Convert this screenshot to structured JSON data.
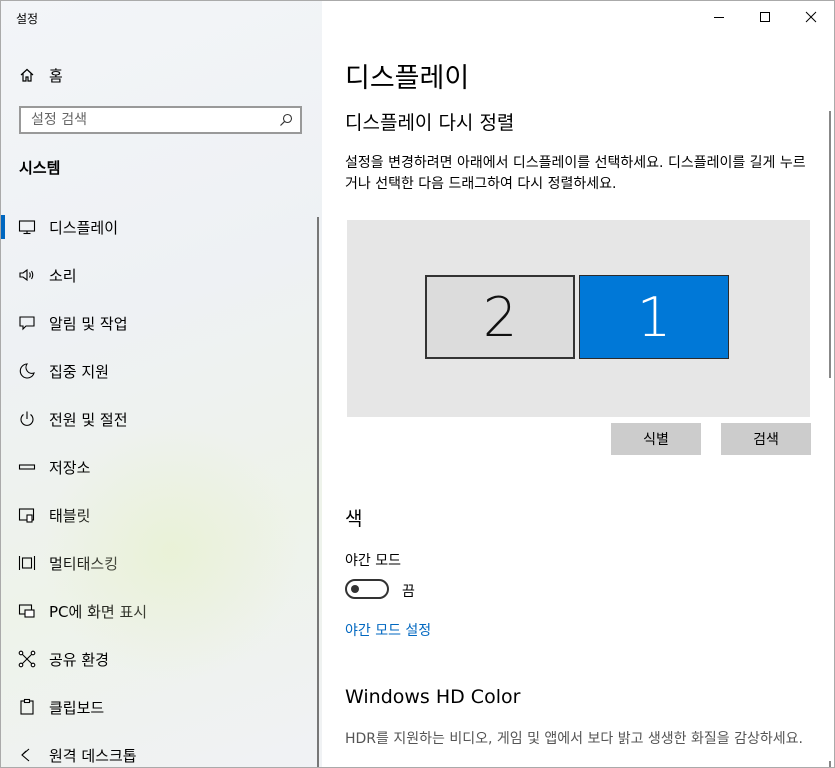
{
  "app": {
    "title": "설정"
  },
  "sidebar": {
    "home_label": "홈",
    "search_placeholder": "설정 검색",
    "section_title": "시스템",
    "items": [
      {
        "label": "디스플레이",
        "icon": "monitor-icon",
        "active": true
      },
      {
        "label": "소리",
        "icon": "speaker-icon"
      },
      {
        "label": "알림 및 작업",
        "icon": "notification-icon"
      },
      {
        "label": "집중 지원",
        "icon": "moon-icon"
      },
      {
        "label": "전원 및 절전",
        "icon": "power-icon"
      },
      {
        "label": "저장소",
        "icon": "storage-icon"
      },
      {
        "label": "태블릿",
        "icon": "tablet-icon"
      },
      {
        "label": "멀티태스킹",
        "icon": "multitasking-icon"
      },
      {
        "label": "PC에 화면 표시",
        "icon": "project-icon"
      },
      {
        "label": "공유 환경",
        "icon": "shared-experiences-icon"
      },
      {
        "label": "클립보드",
        "icon": "clipboard-icon"
      },
      {
        "label": "원격 데스크톱",
        "icon": "remote-desktop-icon"
      }
    ]
  },
  "main": {
    "title": "디스플레이",
    "arrange_title": "디스플레이 다시 정렬",
    "arrange_desc": "설정을 변경하려면 아래에서 디스플레이를 선택하세요. 디스플레이를 길게 누르거나 선택한 다음 드래그하여 다시 정렬하세요.",
    "monitors": [
      {
        "number": "2"
      },
      {
        "number": "1"
      }
    ],
    "identify_label": "식별",
    "detect_label": "검색",
    "color_title": "색",
    "night_light_label": "야간 모드",
    "night_light_state": "끔",
    "night_light_link": "야간 모드 설정",
    "hd_title": "Windows HD Color",
    "hd_desc": "HDR를 지원하는 비디오, 게임 및 앱에서 보다 밝고 생생한 화질을 감상하세요."
  },
  "colors": {
    "accent": "#0078d7",
    "link": "#0067c0"
  }
}
